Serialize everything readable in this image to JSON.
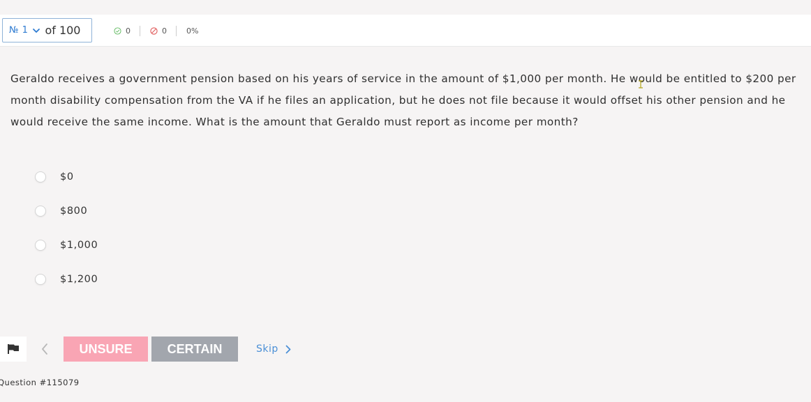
{
  "header": {
    "question_number_label": "№ 1",
    "of_total_label": "of 100",
    "correct_count": "0",
    "incorrect_count": "0",
    "percent": "0%"
  },
  "question": {
    "text": "Geraldo receives a government pension based on his years of service in the amount of $1,000 per month. He would be entitled to $200 per month disability compensation from the VA if he files an application, but he does not file because it would offset his other pension and he would receive the same income. What is the amount that Geraldo must report as income per month?",
    "options": [
      {
        "label": "$0"
      },
      {
        "label": "$800"
      },
      {
        "label": "$1,000"
      },
      {
        "label": "$1,200"
      }
    ]
  },
  "footer": {
    "unsure_label": "UNSURE",
    "certain_label": "CERTAIN",
    "skip_label": "Skip",
    "question_id": "Question #115079"
  },
  "colors": {
    "accent": "#2e7bd1",
    "unsure": "#f9a5b4",
    "certain": "#a2a6ad",
    "correct_icon": "#5cb85c",
    "incorrect_icon": "#e05a5a"
  },
  "icons": [
    "chevron-down-icon",
    "check-circle-icon",
    "ban-icon",
    "flag-icon",
    "chevron-left-icon",
    "chevron-right-icon"
  ]
}
